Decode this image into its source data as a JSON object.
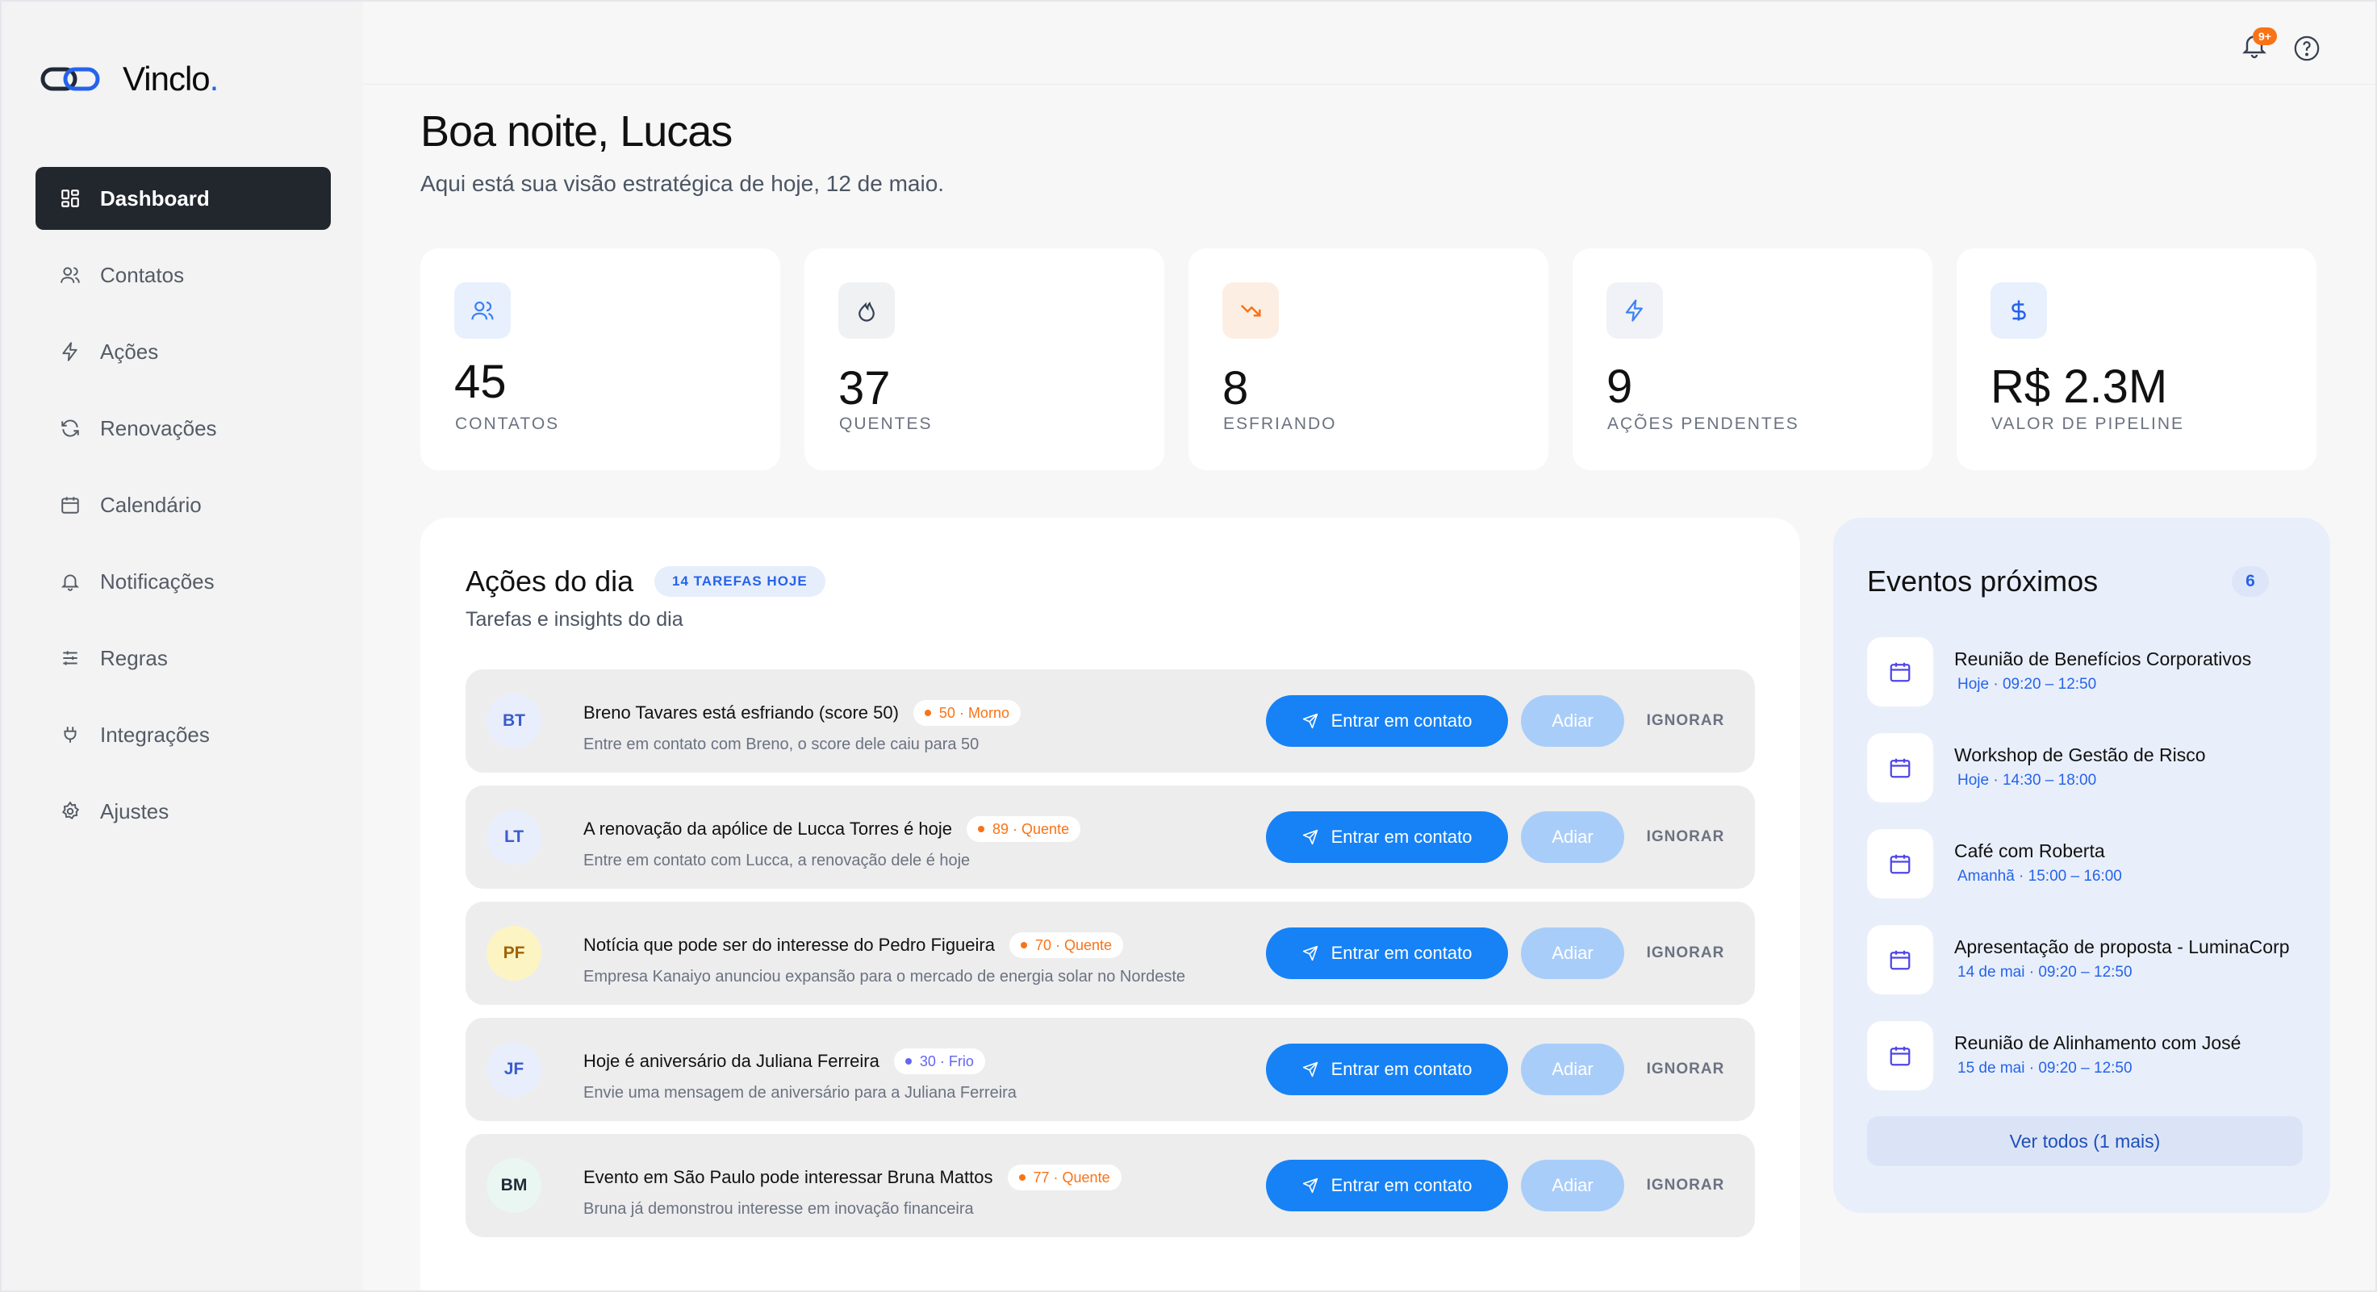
{
  "app": {
    "name": "Vinclo",
    "name_dot": "."
  },
  "sidebar": {
    "items": [
      {
        "label": "Dashboard",
        "icon": "dashboard-icon"
      },
      {
        "label": "Contatos",
        "icon": "users-icon"
      },
      {
        "label": "Ações",
        "icon": "bolt-icon"
      },
      {
        "label": "Renovações",
        "icon": "refresh-icon"
      },
      {
        "label": "Calendário",
        "icon": "calendar-icon"
      },
      {
        "label": "Notificações",
        "icon": "bell-icon"
      },
      {
        "label": "Regras",
        "icon": "sliders-icon"
      },
      {
        "label": "Integrações",
        "icon": "plug-icon"
      },
      {
        "label": "Ajustes",
        "icon": "gear-icon"
      }
    ]
  },
  "topbar": {
    "notifications_badge": "9+"
  },
  "header": {
    "greeting": "Boa noite, Lucas",
    "subtitle": "Aqui está sua visão estratégica de hoje, 12 de maio."
  },
  "stats": [
    {
      "value": "45",
      "label": "CONTATOS",
      "icon": "users-icon",
      "color": "#3b82f6"
    },
    {
      "value": "37",
      "label": "QUENTES",
      "icon": "flame-icon",
      "color": "#374151"
    },
    {
      "value": "8",
      "label": "ESFRIANDO",
      "icon": "trend-down-icon",
      "color": "#f97316"
    },
    {
      "value": "9",
      "label": "AÇÕES PENDENTES",
      "icon": "bolt-icon",
      "color": "#3b82f6"
    },
    {
      "value": "R$ 2.3M",
      "label": "VALOR DE PIPELINE",
      "icon": "dollar-icon",
      "color": "#2563eb"
    }
  ],
  "actions": {
    "title": "Ações do dia",
    "tag": "14 TAREFAS HOJE",
    "subtitle": "Tarefas e insights do dia",
    "contact_label": "Entrar em contato",
    "postpone_label": "Adiar",
    "ignore_label": "IGNORAR",
    "rows": [
      {
        "initials": "BT",
        "title": "Breno Tavares está esfriando (score 50)",
        "chip": "50 · Morno",
        "chip_color": "#f97316",
        "desc": "Entre em contato com Breno, o score dele caiu para 50"
      },
      {
        "initials": "LT",
        "title": "A renovação da apólice de Lucca Torres é hoje",
        "chip": "89 · Quente",
        "chip_color": "#f97316",
        "desc": "Entre em contato com Lucca, a renovação dele é hoje"
      },
      {
        "initials": "PF",
        "title": "Notícia que pode ser do interesse do Pedro Figueira",
        "chip": "70 · Quente",
        "chip_color": "#f97316",
        "desc": "Empresa Kanaiyo anunciou expansão para o mercado de energia solar no Nordeste"
      },
      {
        "initials": "JF",
        "title": "Hoje é aniversário da Juliana Ferreira",
        "chip": "30 · Frio",
        "chip_color": "#6366f1",
        "desc": "Envie uma mensagem de aniversário para a Juliana Ferreira"
      },
      {
        "initials": "BM",
        "title": "Evento em São Paulo pode interessar Bruna Mattos",
        "chip": "77 · Quente",
        "chip_color": "#f97316",
        "desc": "Bruna já demonstrou interesse em inovação financeira"
      }
    ]
  },
  "events": {
    "title": "Eventos próximos",
    "count": "6",
    "view_all": "Ver todos (1 mais)",
    "items": [
      {
        "name": "Reunião de Benefícios Corporativos",
        "time": "Hoje · 09:20 – 12:50"
      },
      {
        "name": "Workshop de Gestão de Risco",
        "time": "Hoje · 14:30 – 18:00"
      },
      {
        "name": "Café com Roberta",
        "time": "Amanhã · 15:00 – 16:00"
      },
      {
        "name": "Apresentação de proposta - LuminaCorp",
        "time": "14 de mai · 09:20 – 12:50"
      },
      {
        "name": "Reunião de Alinhamento com José",
        "time": "15 de mai · 09:20 – 12:50"
      }
    ]
  }
}
